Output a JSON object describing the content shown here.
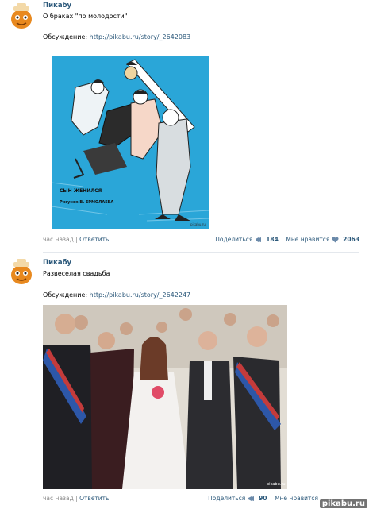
{
  "posts": [
    {
      "author": "Пикабу",
      "title": "О браках \"по молодости\"",
      "discussion_label": "Обсуждение:",
      "discussion_link": "http://pikabu.ru/story/_2642083",
      "image": {
        "caption1": "СЫН ЖЕНИЛСЯ",
        "caption2": "Рисунок В. ЕРМОЛАЕВА",
        "background": "#2aa6d8",
        "credit": "pikabu.ru"
      },
      "footer": {
        "time": "час назад",
        "separator": "|",
        "reply": "Ответить",
        "share_label": "Поделиться",
        "share_count": "184",
        "like_label": "Мне нравится",
        "like_count": "2063"
      }
    },
    {
      "author": "Пикабу",
      "title": "Развеселая свадьба",
      "discussion_label": "Обсуждение:",
      "discussion_link": "http://pikabu.ru/story/_2642247",
      "image": {
        "credit": "pikabu.ru"
      },
      "footer": {
        "time": "час назад",
        "separator": "|",
        "reply": "Ответить",
        "share_label": "Поделиться",
        "share_count": "90",
        "like_label": "Мне нравится"
      }
    }
  ],
  "watermark": "pikabu.ru",
  "colors": {
    "link": "#2b587a",
    "muted": "#8a8a8a",
    "accent_orange": "#e8891f"
  }
}
